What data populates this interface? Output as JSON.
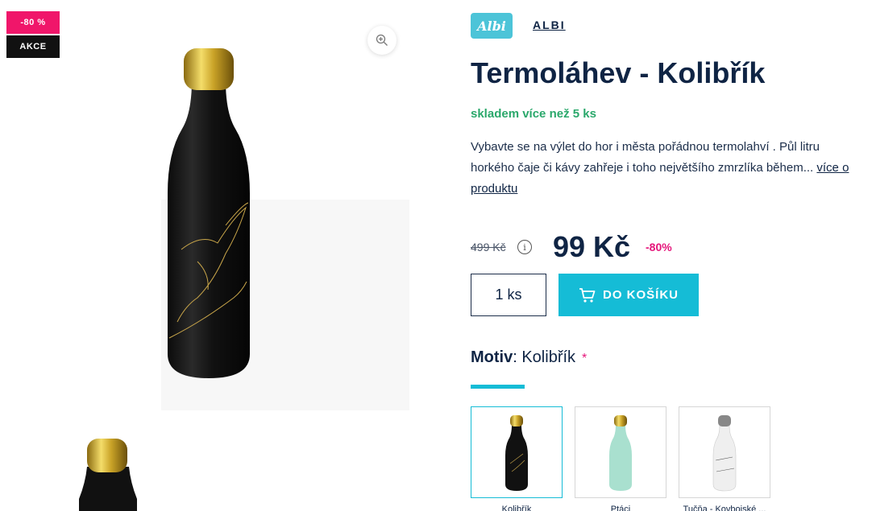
{
  "badges": {
    "discount": "-80 %",
    "sale": "AKCE"
  },
  "icons": {
    "zoom": "zoom-in-icon",
    "info": "info-icon",
    "cart": "cart-icon"
  },
  "brand": {
    "logo_text": "Albi",
    "name": "ALBI"
  },
  "product": {
    "title": "Termoláhev - Kolibřík",
    "stock": "skladem více než 5 ks",
    "description": "Vybavte se na výlet do hor i města pořádnou termolahví . Půl litru",
    "description_line2": "horkého čaje či kávy zahřeje i toho největšího zmrzlíka během...",
    "more_link": "více o",
    "more_link_line2": "produktu"
  },
  "pricing": {
    "old_price": "499 Kč",
    "info_symbol": "i",
    "price": "99 Kč",
    "discount": "-80%"
  },
  "purchase": {
    "quantity": "1 ks",
    "cart_label": "DO KOŠÍKU"
  },
  "variants": {
    "label": "Motiv",
    "separator": ":",
    "selected": "Kolibřík",
    "required_mark": "*",
    "options": [
      {
        "name": "Kolibřík",
        "selected": true
      },
      {
        "name": "Ptáci",
        "selected": false
      },
      {
        "name": "Tučňa - Kovbojské ...",
        "selected": false
      }
    ]
  },
  "colors": {
    "accent": "#15bcd6",
    "brand_blue": "#0f2444",
    "discount_pink": "#f0166a",
    "stock_green": "#2aa86b"
  }
}
